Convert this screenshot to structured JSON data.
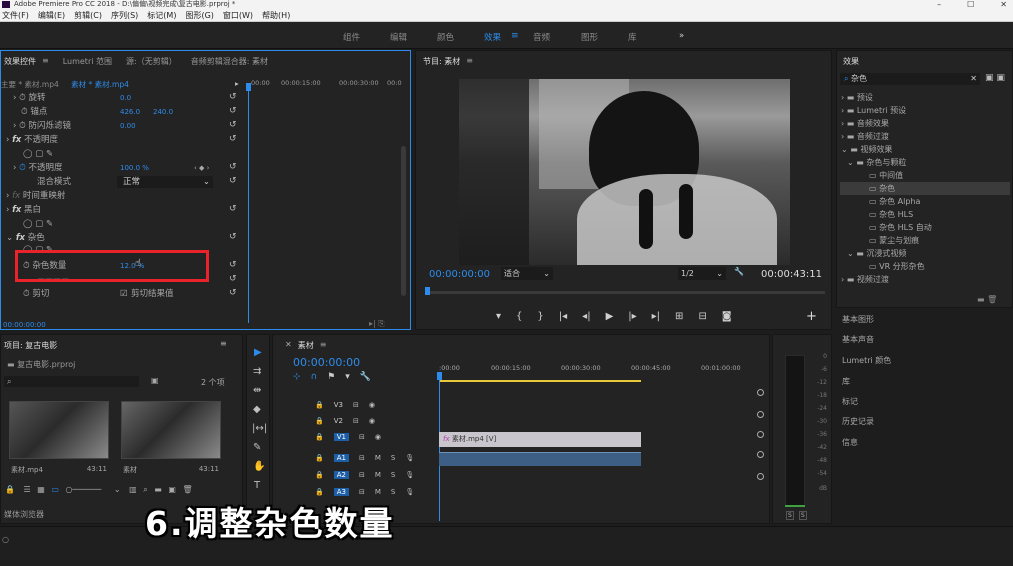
{
  "window": {
    "title": "Adobe Premiere Pro CC 2018 - D:\\偏偏\\视频完成\\复古电影.prproj *",
    "minimize": "–",
    "maximize": "☐",
    "close": "✕"
  },
  "menu": [
    "文件(F)",
    "编辑(E)",
    "剪辑(C)",
    "序列(S)",
    "标记(M)",
    "图形(G)",
    "窗口(W)",
    "帮助(H)"
  ],
  "workspaces": {
    "items": [
      "组件",
      "编辑",
      "颜色",
      "效果",
      "音频",
      "图形",
      "库"
    ],
    "active": "效果",
    "more": "»"
  },
  "effect_controls": {
    "tabs": [
      "效果控件",
      "Lumetri 范围",
      "源:（无剪辑）",
      "音频剪辑混合器: 素材"
    ],
    "master": "主要 * 素材.mp4",
    "clip": "素材 * 素材.mp4",
    "times": [
      "00:00",
      "00:00:15:00",
      "00:00:30:00",
      "00:0"
    ],
    "rows": {
      "rotation": "旋转",
      "rotation_val": "0.0",
      "anchor": "锚点",
      "anchor_x": "426.0",
      "anchor_y": "240.0",
      "flicker": "防闪烁滤镜",
      "flicker_val": "0.00",
      "opacity_fx": "不透明度",
      "opacity": "不透明度",
      "opacity_val": "100.0 %",
      "blend": "混合模式",
      "blend_val": "正常",
      "timeremap": "时间重映射",
      "bw_fx": "黑白",
      "noise_fx": "杂色",
      "noise_amount": "杂色数量",
      "noise_amount_val": "12.0 %",
      "clip_row": "剪切",
      "clip_result": "剪切结果值"
    },
    "timecode": "00:00:00:00"
  },
  "program": {
    "tab": "节目: 素材",
    "timecode": "00:00:00:00",
    "fit": "适合",
    "resolution": "1/2",
    "duration": "00:00:43:11"
  },
  "effects_panel": {
    "title": "效果",
    "search": "杂色",
    "tree": [
      "预设",
      "Lumetri 预设",
      "音频效果",
      "音频过渡",
      "视频效果",
      "杂色与颗粒",
      "中间值",
      "杂色",
      "杂色 Alpha",
      "杂色 HLS",
      "杂色 HLS 自动",
      "蒙尘与划痕",
      "沉浸式视频",
      "VR 分形杂色",
      "视频过渡"
    ],
    "side_panels": [
      "基本图形",
      "基本声音",
      "Lumetri 颜色",
      "库",
      "标记",
      "历史记录",
      "信息"
    ]
  },
  "project": {
    "title": "项目: 复古电影",
    "file": "复古电影.prproj",
    "count": "2 个项",
    "items": [
      {
        "name": "素材.mp4",
        "dur": "43:11"
      },
      {
        "name": "素材",
        "dur": "43:11"
      }
    ],
    "media_browser": "媒体浏览器"
  },
  "timeline": {
    "tab": "素材",
    "timecode": "00:00:00:00",
    "ruler": [
      ":00:00",
      "00:00:15:00",
      "00:00:30:00",
      "00:00:45:00",
      "00:01:00:00"
    ],
    "video_tracks": [
      "V3",
      "V2",
      "V1"
    ],
    "audio_tracks": [
      "A1",
      "A2",
      "A3"
    ],
    "clip_label": "素材.mp4 [V]"
  },
  "meter": {
    "labels": [
      "0",
      "-6",
      "-12",
      "-18",
      "-24",
      "-30",
      "-36",
      "-42",
      "-48",
      "-54",
      "dB"
    ],
    "solo": [
      "S",
      "S"
    ]
  },
  "overlay": "6.调整杂色数量"
}
